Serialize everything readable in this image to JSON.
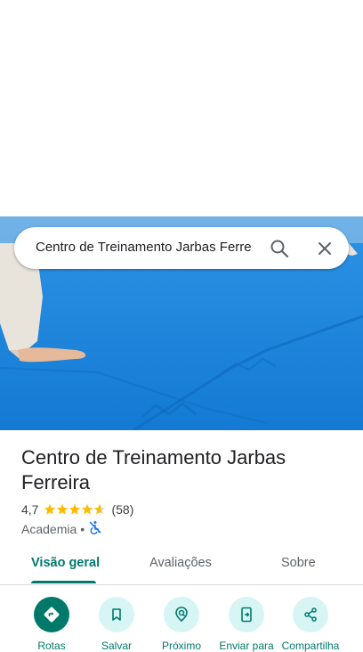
{
  "search": {
    "query": "Centro de Treinamento Jarbas Ferre"
  },
  "place": {
    "name": "Centro de Treinamento Jarbas Ferreira",
    "rating": "4,7",
    "stars": 4.7,
    "review_count": "(58)",
    "category": "Academia",
    "separator": "•"
  },
  "tabs": [
    {
      "label": "Visão geral",
      "active": true
    },
    {
      "label": "Avaliações"
    },
    {
      "label": "Sobre"
    }
  ],
  "actions": [
    {
      "label": "Rotas",
      "icon": "directions-icon"
    },
    {
      "label": "Salvar",
      "icon": "bookmark-icon"
    },
    {
      "label": "Próximo",
      "icon": "nearby-icon"
    },
    {
      "label": "Enviar para",
      "icon": "send-to-phone-icon"
    },
    {
      "label": "Compartilha",
      "icon": "share-icon"
    }
  ],
  "colors": {
    "accent": "#00796b",
    "star": "#fbbc04",
    "chip_bg": "#d7f5f5"
  }
}
